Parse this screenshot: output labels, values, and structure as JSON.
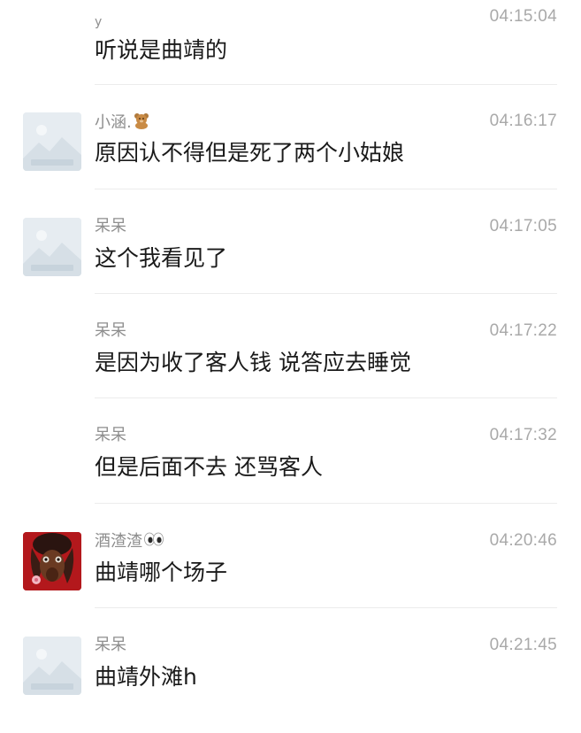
{
  "messages": [
    {
      "name": "y",
      "time": "04:15:04",
      "text": "听说是曲靖的",
      "avatar": "none",
      "name_emoji": ""
    },
    {
      "name": "小涵.",
      "time": "04:16:17",
      "text": "原因认不得但是死了两个小姑娘",
      "avatar": "placeholder",
      "name_emoji": "teddy-bear"
    },
    {
      "name": "呆呆",
      "time": "04:17:05",
      "text": "这个我看见了",
      "avatar": "placeholder",
      "name_emoji": ""
    },
    {
      "name": "呆呆",
      "time": "04:17:22",
      "text": "是因为收了客人钱 说答应去睡觉",
      "avatar": "none",
      "name_emoji": ""
    },
    {
      "name": "呆呆",
      "time": "04:17:32",
      "text": "但是后面不去 还骂客人",
      "avatar": "none",
      "name_emoji": ""
    },
    {
      "name": "酒渣渣",
      "time": "04:20:46",
      "text": "曲靖哪个场子",
      "avatar": "photo",
      "name_emoji": "eyes"
    },
    {
      "name": "呆呆",
      "time": "04:21:45",
      "text": "曲靖外滩h",
      "avatar": "placeholder",
      "name_emoji": ""
    }
  ],
  "colors": {
    "name": "#8e8e8e",
    "time": "#a9a9a9",
    "text": "#1a1a1a",
    "divider": "#ececec",
    "placeholder_bg": "#e6ecf1",
    "photo_bg": "#b3181c"
  }
}
